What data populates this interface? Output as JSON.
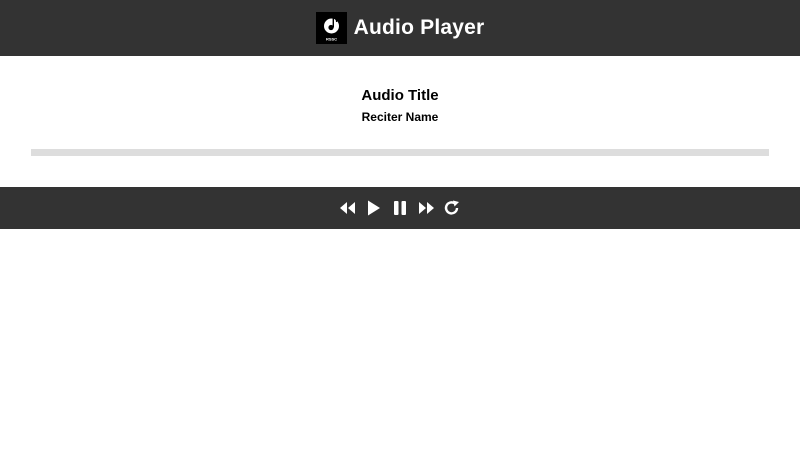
{
  "header": {
    "title": "Audio Player",
    "logo_text": "RSSC"
  },
  "track": {
    "title": "Audio Title",
    "reciter": "Reciter Name"
  },
  "progress": {
    "fraction": 0
  },
  "controls": [
    {
      "name": "rewind",
      "icon": "backward-icon"
    },
    {
      "name": "play",
      "icon": "play-icon"
    },
    {
      "name": "pause",
      "icon": "pause-icon"
    },
    {
      "name": "fast-forward",
      "icon": "forward-icon"
    },
    {
      "name": "repeat",
      "icon": "redo-icon"
    }
  ],
  "colors": {
    "bar": "#333333",
    "background": "#ffffff",
    "progress_track": "#dddddd",
    "text_light": "#ffffff"
  }
}
